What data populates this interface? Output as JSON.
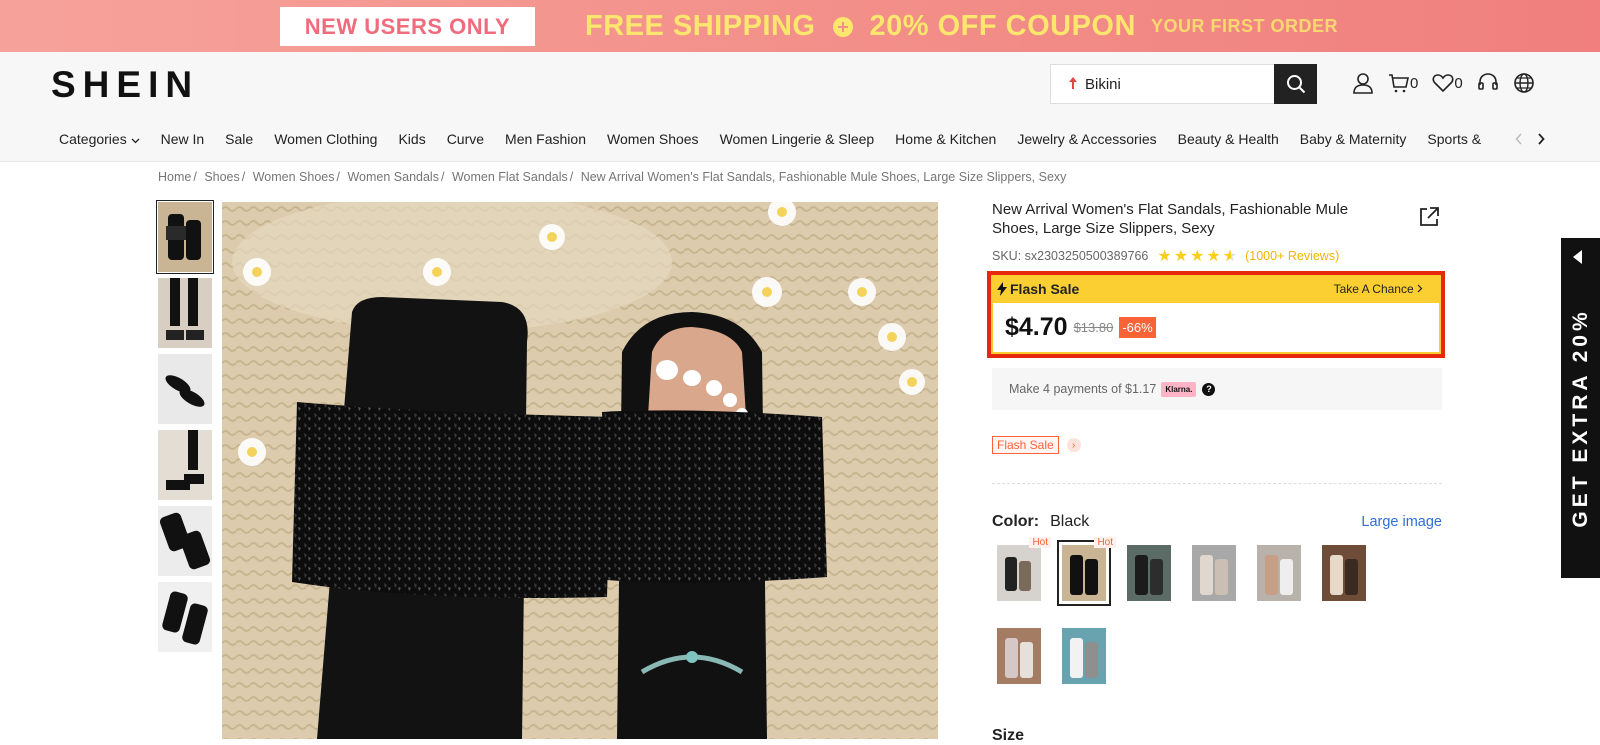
{
  "promo": {
    "new_users": "NEW USERS ONLY",
    "free_shipping": "FREE SHIPPING",
    "coupon": "20% OFF COUPON",
    "first_order": "YOUR FIRST ORDER"
  },
  "header": {
    "logo": "SHEIN",
    "search_value": "Bikini",
    "cart_count": "0",
    "wishlist_count": "0"
  },
  "nav": {
    "items": [
      "Categories",
      "New In",
      "Sale",
      "Women Clothing",
      "Kids",
      "Curve",
      "Men Fashion",
      "Women Shoes",
      "Women Lingerie & Sleep",
      "Home & Kitchen",
      "Jewelry & Accessories",
      "Beauty & Health",
      "Baby & Maternity",
      "Sports &"
    ]
  },
  "breadcrumb": [
    "Home",
    "Shoes",
    "Women Shoes",
    "Women Sandals",
    "Women Flat Sandals",
    "New Arrival Women's Flat Sandals, Fashionable Mule Shoes, Large Size Slippers, Sexy"
  ],
  "product": {
    "title": "New Arrival Women's Flat Sandals, Fashionable Mule Shoes, Large Size Slippers, Sexy",
    "sku": "SKU: sx2303250500389766",
    "rating_stars": 4.5,
    "reviews": "(1000+ Reviews)",
    "flash_label": "Flash Sale",
    "take_chance": "Take A Chance",
    "price": "$4.70",
    "old_price": "$13.80",
    "discount": "-66%",
    "klarna_text": "Make 4 payments of $1.17",
    "klarna_badge": "Klarna.",
    "flash_tag": "Flash Sale",
    "color_label": "Color:",
    "color_value": "Black",
    "large_image": "Large image",
    "hot": "Hot",
    "size_label": "Size"
  },
  "side_tab": {
    "text": "GET EXTRA 20%"
  },
  "colors": {
    "accent_red": "#e8270f",
    "flash_yellow": "#fbce32",
    "discount_orange": "#fa6338",
    "link_blue": "#2f6fd9"
  }
}
